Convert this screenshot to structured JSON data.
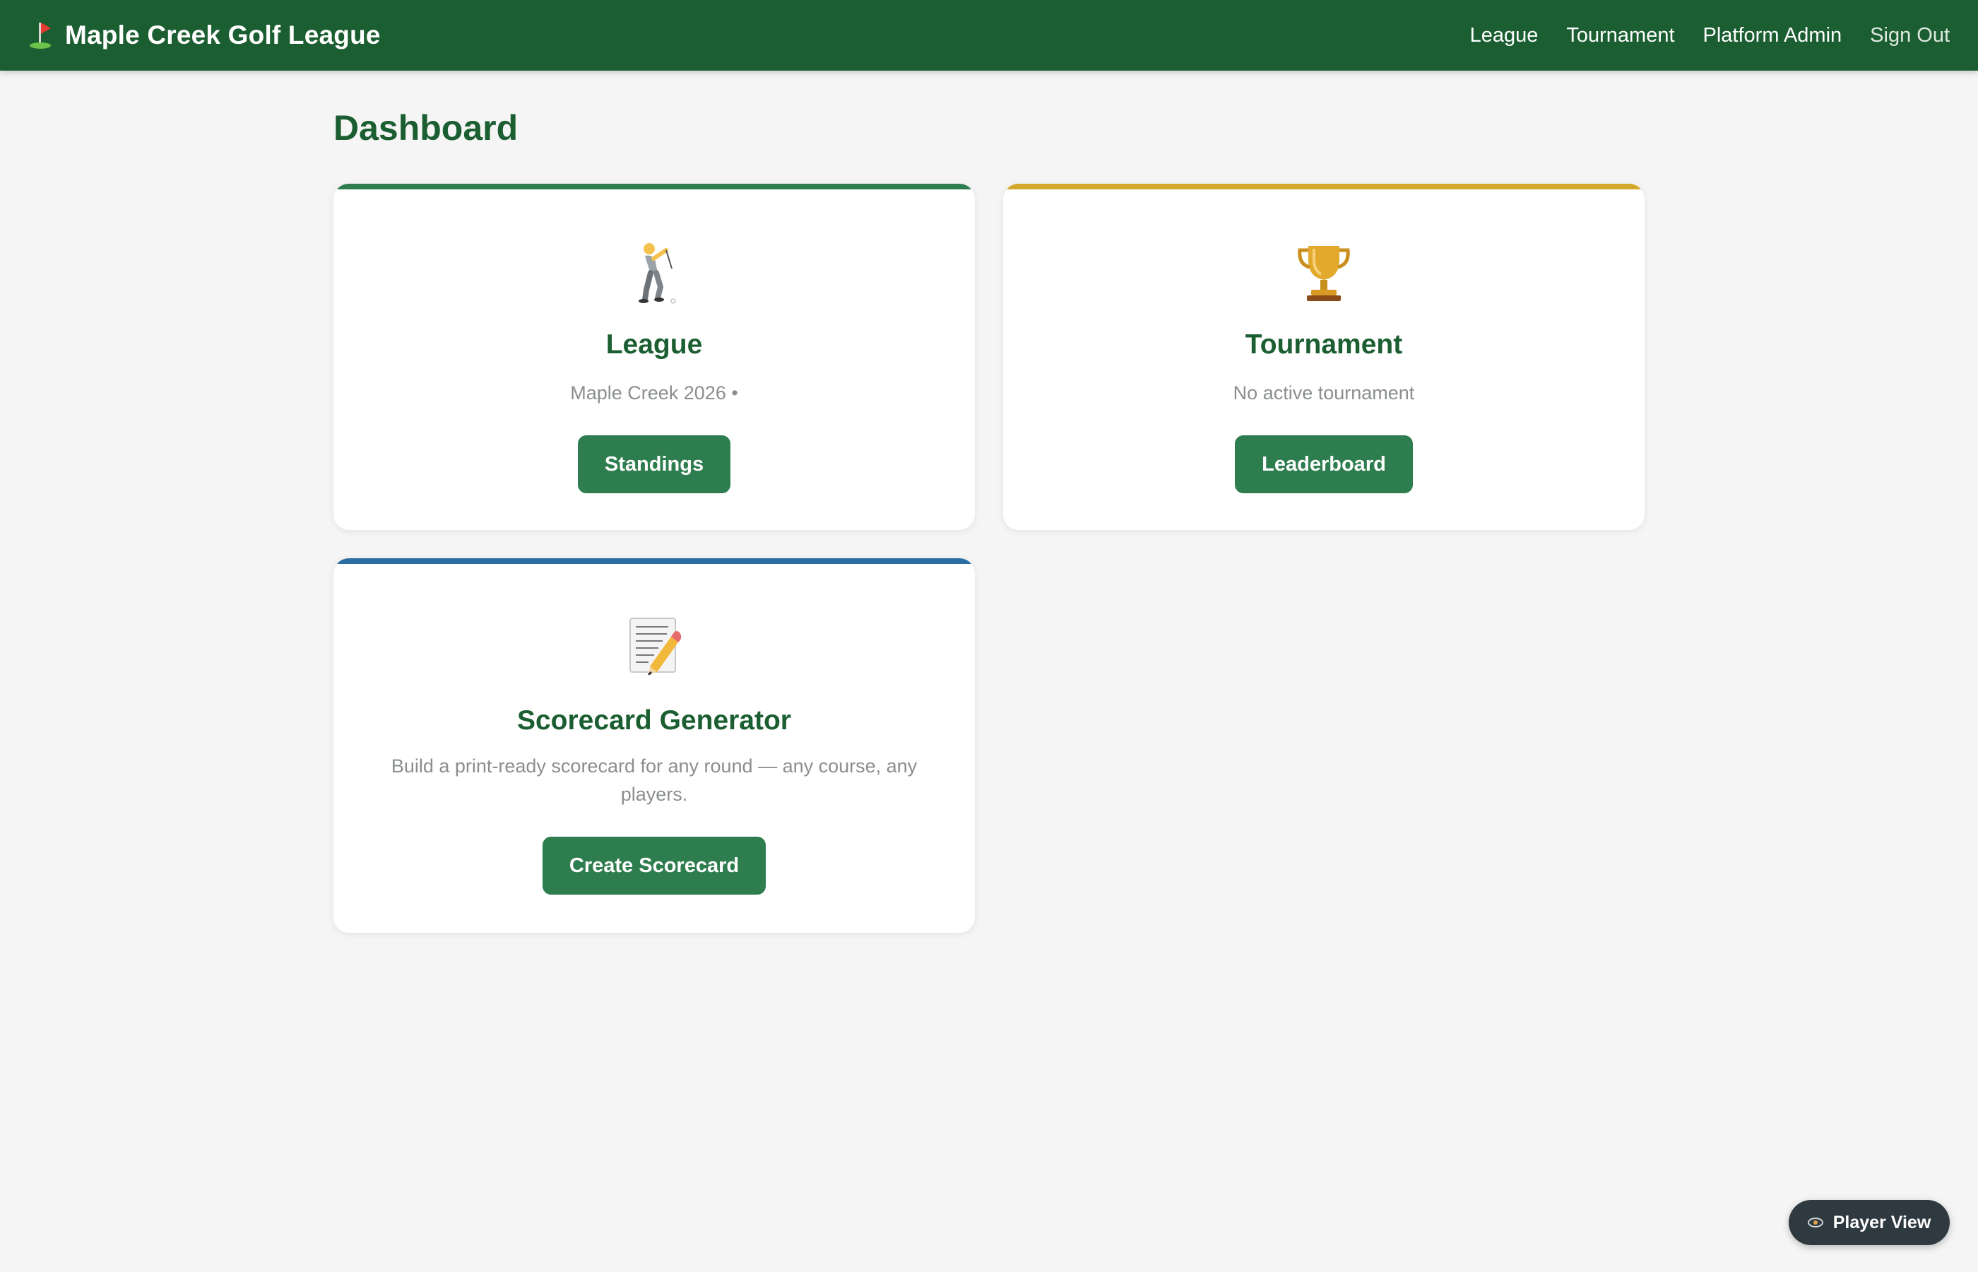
{
  "header": {
    "brand_title": "Maple Creek Golf League",
    "brand_icon": "golf-flag-icon",
    "nav": [
      {
        "label": "League"
      },
      {
        "label": "Tournament"
      },
      {
        "label": "Platform Admin"
      },
      {
        "label": "Sign Out"
      }
    ]
  },
  "page": {
    "title": "Dashboard"
  },
  "cards": {
    "league": {
      "icon": "golfer-icon",
      "title": "League",
      "subtitle": "Maple Creek 2026 •",
      "button": "Standings",
      "accent": "#2e7d4f"
    },
    "tournament": {
      "icon": "trophy-icon",
      "title": "Tournament",
      "subtitle": "No active tournament",
      "button": "Leaderboard",
      "accent": "#d4a82a"
    },
    "scorecard": {
      "icon": "memo-pencil-icon",
      "title": "Scorecard Generator",
      "subtitle": "Build a print-ready scorecard for any round — any course, any players.",
      "button": "Create Scorecard",
      "accent": "#2a6fa3"
    }
  },
  "player_view": {
    "label": "Player View",
    "icon": "eye-icon"
  },
  "colors": {
    "header_bg": "#1b5e31",
    "primary_button": "#2e7d4f",
    "page_bg": "#f5f5f5"
  }
}
